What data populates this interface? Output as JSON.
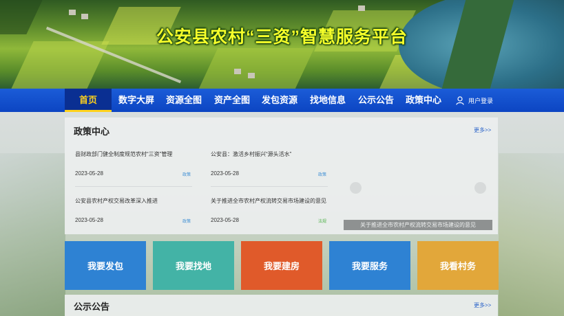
{
  "site": {
    "title": "公安县农村“三资”智慧服务平台"
  },
  "nav": {
    "items": [
      "首页",
      "数字大屏",
      "资源全图",
      "资产全图",
      "发包资源",
      "找地信息",
      "公示公告",
      "政策中心"
    ],
    "active": "首页",
    "login_label": "用户登录"
  },
  "policy": {
    "title": "政策中心",
    "more": "更多>>",
    "news": [
      {
        "title": "县财政部门健全制度规范农村“三资”管理",
        "date": "2023-05-28",
        "tag": "政策"
      },
      {
        "title": "公安县：激活乡村振兴“源头活水”",
        "date": "2023-05-28",
        "tag": "政策"
      },
      {
        "title": "公安县农村产权交易改革深入推进",
        "date": "2023-05-28",
        "tag": "政策"
      },
      {
        "title": "关于推进全市农村产权流转交易市场建设的意见",
        "date": "2023-05-28",
        "tag": "法规"
      }
    ],
    "carousel_caption": "关于推进全市农村产权流转交易市场建设的意见"
  },
  "tiles": [
    {
      "label": "我要发包",
      "color": "#2e82d3"
    },
    {
      "label": "我要找地",
      "color": "#43b3a6"
    },
    {
      "label": "我要建房",
      "color": "#e05a2a"
    },
    {
      "label": "我要服务",
      "color": "#2e82d3"
    },
    {
      "label": "我看村务",
      "color": "#e2a73a"
    }
  ],
  "notices": {
    "title": "公示公告",
    "more": "更多>>"
  },
  "colors": {
    "nav_bg": "#0c45c2",
    "active_text": "#ffd21c",
    "title_yellow": "#f6ff2a"
  }
}
